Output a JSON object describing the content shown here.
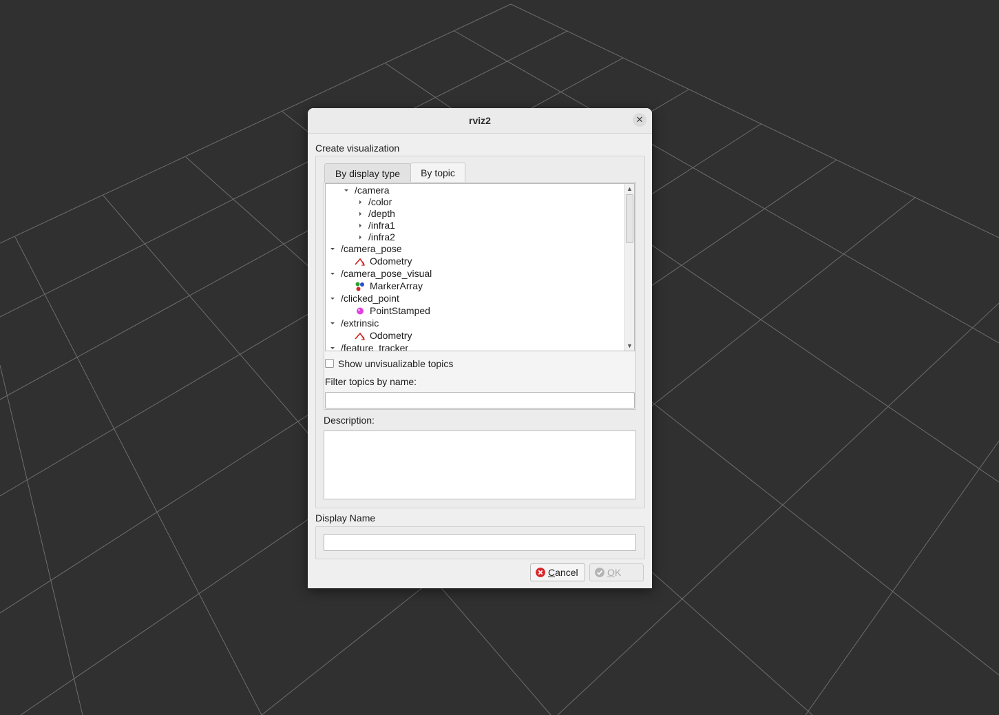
{
  "window": {
    "title": "rviz2",
    "close_glyph": "✕"
  },
  "dialog": {
    "heading": "Create visualization",
    "tabs": [
      {
        "label": "By display type",
        "active": false
      },
      {
        "label": "By topic",
        "active": true
      }
    ],
    "topic_tree": [
      {
        "label": "/camera",
        "expanded": true
      },
      {
        "label": "/color",
        "expanded": false
      },
      {
        "label": "/depth",
        "expanded": false
      },
      {
        "label": "/infra1",
        "expanded": false
      },
      {
        "label": "/infra2",
        "expanded": false
      },
      {
        "label": "/camera_pose",
        "expanded": true
      },
      {
        "label": "Odometry",
        "icon": "odometry-icon"
      },
      {
        "label": "/camera_pose_visual",
        "expanded": true
      },
      {
        "label": "MarkerArray",
        "icon": "marker-array-icon"
      },
      {
        "label": "/clicked_point",
        "expanded": true
      },
      {
        "label": "PointStamped",
        "icon": "point-stamped-icon"
      },
      {
        "label": "/extrinsic",
        "expanded": true
      },
      {
        "label": "Odometry",
        "icon": "odometry-icon"
      },
      {
        "label": "/feature_tracker",
        "expanded": true
      }
    ],
    "show_unvisualizable": {
      "label": "Show unvisualizable topics",
      "checked": false
    },
    "filter": {
      "label": "Filter topics by name:",
      "value": ""
    },
    "description": {
      "label": "Description:",
      "text": ""
    },
    "display_name": {
      "label": "Display Name",
      "value": ""
    },
    "buttons": {
      "cancel": {
        "label": "Cancel",
        "icon": "cancel-icon",
        "enabled": true
      },
      "ok": {
        "label": "OK",
        "icon": "ok-icon",
        "enabled": false
      }
    }
  },
  "colors": {
    "background": "#303030",
    "grid": "#a0a0a0",
    "cancel_icon": "#d9252b",
    "odometry_icon": "#cc1f1f",
    "point_stamped_icon": "#e040e0"
  }
}
